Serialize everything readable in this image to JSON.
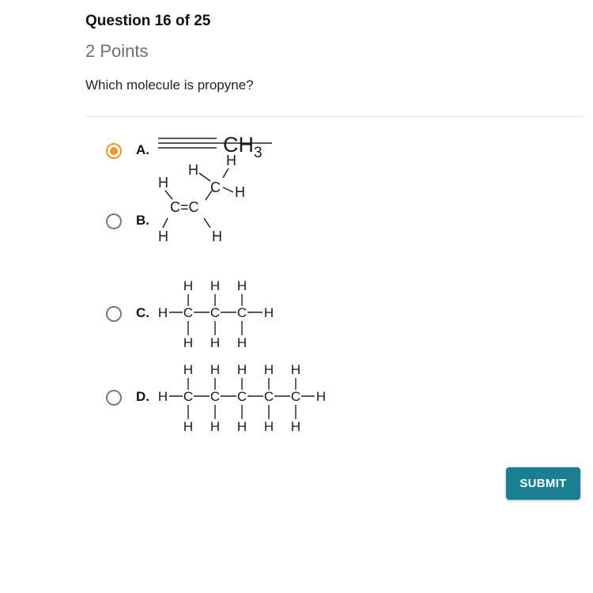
{
  "question": {
    "title": "Question 16 of 25",
    "points": "2 Points",
    "prompt": "Which molecule is propyne?"
  },
  "options": [
    {
      "letter": "A.",
      "selected": true,
      "structure": {
        "group": "CH",
        "subscript": "3"
      }
    },
    {
      "letter": "B.",
      "selected": false,
      "structure": {
        "atom_h": "H",
        "atom_c": "C",
        "double_bond": "C=C"
      }
    },
    {
      "letter": "C.",
      "selected": false,
      "structure": {
        "atom_h": "H",
        "atom_c": "C",
        "bond": "—",
        "vbond": "|"
      }
    },
    {
      "letter": "D.",
      "selected": false,
      "structure": {
        "atom_h": "H",
        "atom_c": "C",
        "bond": "—",
        "vbond": "|"
      }
    }
  ],
  "submit": {
    "label": "SUBMIT"
  },
  "colors": {
    "accent": "#f29322",
    "submit_bg": "#1a7f93",
    "radio_border": "#7a7a7a"
  }
}
